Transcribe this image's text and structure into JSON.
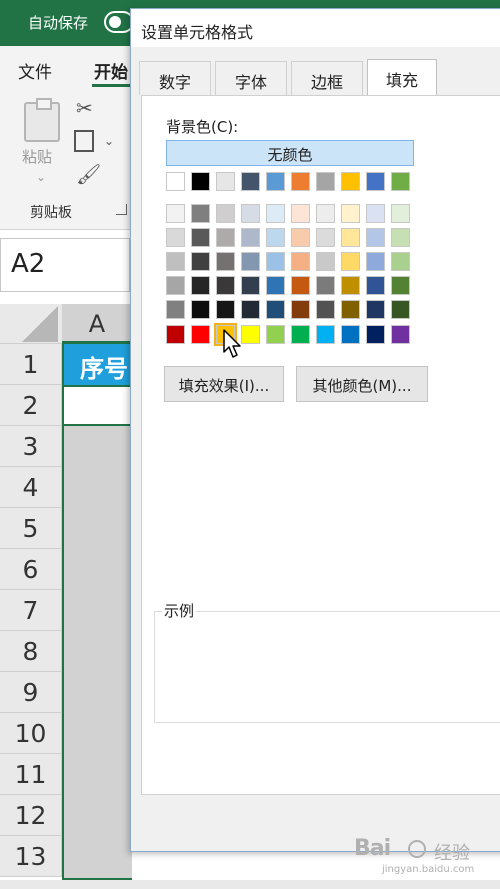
{
  "excel": {
    "autosave_label": "自动保存",
    "menu": {
      "file": "文件",
      "home": "开始"
    },
    "ribbon": {
      "paste_label": "粘贴",
      "clipboard_group": "剪贴板"
    },
    "name_box": "A2",
    "column_header": "A",
    "row_numbers": [
      "1",
      "2",
      "3",
      "4",
      "5",
      "6",
      "7",
      "8",
      "9",
      "10",
      "11",
      "12",
      "13"
    ],
    "header_cell_text": "序号",
    "colors": {
      "titlebar": "#217346",
      "header_fill": "#1fa0dc",
      "selection": "#217346"
    }
  },
  "dialog": {
    "title": "设置单元格格式",
    "tabs": [
      "数字",
      "字体",
      "边框",
      "填充"
    ],
    "active_tab": "填充",
    "background_color_label": "背景色(C):",
    "no_color_button": "无颜色",
    "palette": {
      "top_row": [
        "#ffffff",
        "#000000",
        "#e7e6e6",
        "#44546a",
        "#5b9bd5",
        "#ed7d31",
        "#a5a5a5",
        "#ffc000",
        "#4472c4",
        "#70ad47"
      ],
      "shade_rows": [
        [
          "#f2f2f2",
          "#7f7f7f",
          "#d0cece",
          "#d6dce5",
          "#ddebf7",
          "#fce4d6",
          "#ededed",
          "#fff2cc",
          "#d9e1f2",
          "#e2efda"
        ],
        [
          "#d9d9d9",
          "#595959",
          "#aeaaaa",
          "#adb9ca",
          "#bdd7ee",
          "#f8cbad",
          "#dbdbdb",
          "#ffe699",
          "#b4c6e7",
          "#c6e0b4"
        ],
        [
          "#bfbfbf",
          "#404040",
          "#757171",
          "#8497b0",
          "#9bc2e6",
          "#f4b084",
          "#c9c9c9",
          "#ffd966",
          "#8ea9db",
          "#a9d08e"
        ],
        [
          "#a6a6a6",
          "#262626",
          "#3a3838",
          "#333f4f",
          "#2f75b5",
          "#c65911",
          "#7b7b7b",
          "#bf8f00",
          "#305496",
          "#548235"
        ],
        [
          "#808080",
          "#0d0d0d",
          "#161616",
          "#222b35",
          "#1f4e78",
          "#833c0c",
          "#525252",
          "#806000",
          "#203764",
          "#375623"
        ]
      ],
      "standard_row": [
        "#c00000",
        "#ff0000",
        "#ffc000",
        "#ffff00",
        "#92d050",
        "#00b050",
        "#00b0f0",
        "#0070c0",
        "#002060",
        "#7030a0"
      ],
      "hovered_index": 2
    },
    "fill_effects_button": "填充效果(I)...",
    "more_colors_button": "其他颜色(M)...",
    "sample_label": "示例"
  },
  "watermark": {
    "logo": "Bai",
    "brand": "经验",
    "url": "jingyan.baidu.com"
  }
}
